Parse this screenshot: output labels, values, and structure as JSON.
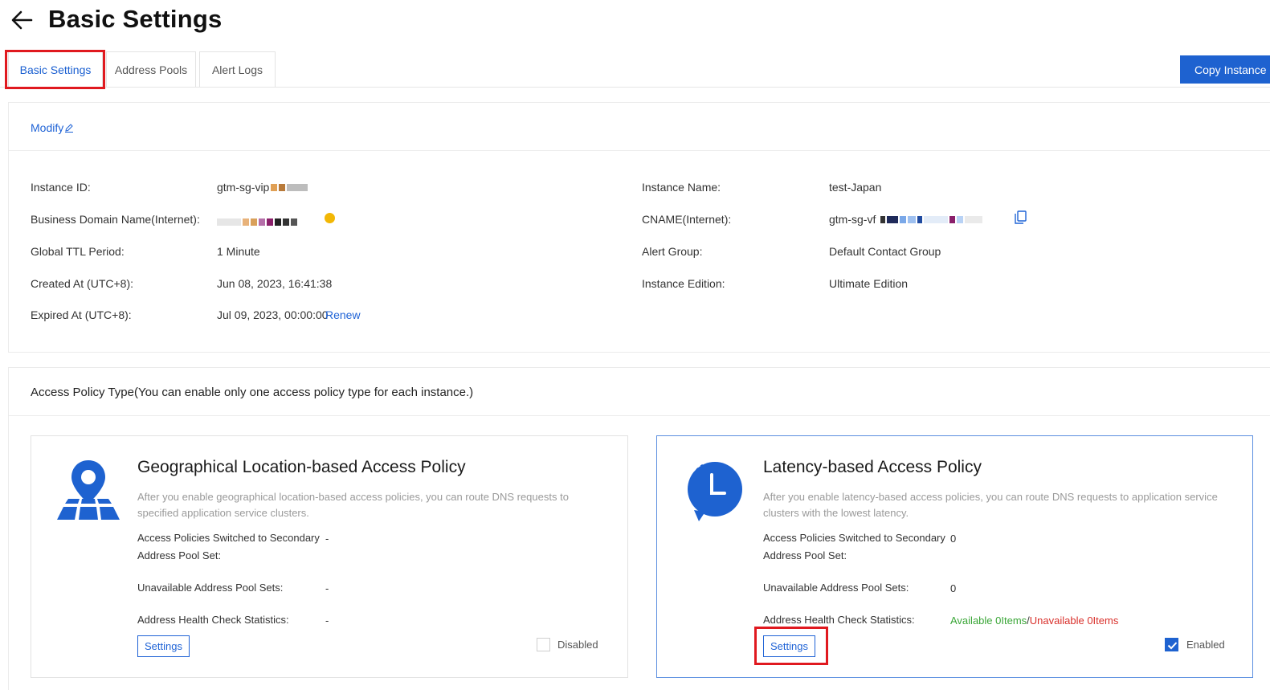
{
  "header": {
    "title": "Basic Settings"
  },
  "tabs": [
    {
      "label": "Basic Settings"
    },
    {
      "label": "Address Pools"
    },
    {
      "label": "Alert Logs"
    }
  ],
  "actions": {
    "copy_instance": "Copy Instance"
  },
  "info": {
    "modify_label": "Modify",
    "left": [
      {
        "label": "Instance ID:",
        "value": "gtm-sg-vip"
      },
      {
        "label": "Business Domain Name(Internet):",
        "value": ""
      },
      {
        "label": "Global TTL Period:",
        "value": "1 Minute"
      },
      {
        "label": "Created At (UTC+8):",
        "value": "Jun 08, 2023, 16:41:38"
      },
      {
        "label": "Expired At (UTC+8):",
        "value": "Jul 09, 2023, 00:00:00"
      }
    ],
    "renew_label": "Renew",
    "right": [
      {
        "label": "Instance Name:",
        "value": "test-Japan"
      },
      {
        "label": "CNAME(Internet):",
        "value": "gtm-sg-vf"
      },
      {
        "label": "Alert Group:",
        "value": "Default Contact Group"
      },
      {
        "label": "Instance Edition:",
        "value": "Ultimate Edition"
      }
    ]
  },
  "policy": {
    "section_title": "Access Policy Type(You can enable only one access policy type for each instance.)",
    "geo": {
      "title": "Geographical Location-based Access Policy",
      "desc": "After you enable geographical location-based access policies, you can route DNS requests to specified application service clusters.",
      "switched_label_1": "Access Policies Switched to Secondary",
      "switched_label_2": "Address Pool Set:",
      "switched_value": "-",
      "unavailable_label": "Unavailable Address Pool Sets:",
      "unavailable_value": "-",
      "health_label": "Address Health Check Statistics:",
      "health_value": "-",
      "settings_label": "Settings",
      "status_label": "Disabled",
      "enabled": false,
      "icon": "map-pin-icon"
    },
    "latency": {
      "title": "Latency-based Access Policy",
      "desc": "After you enable latency-based access policies, you can route DNS requests to application service clusters with the lowest latency.",
      "switched_label_1": "Access Policies Switched to Secondary",
      "switched_label_2": "Address Pool Set:",
      "switched_value": "0",
      "unavailable_label": "Unavailable Address Pool Sets:",
      "unavailable_value": "0",
      "health_label": "Address Health Check Statistics:",
      "health_available": "Available 0Items",
      "health_sep": "/",
      "health_unavailable": "Unavailable 0Items",
      "settings_label": "Settings",
      "status_label": "Enabled",
      "enabled": true,
      "icon": "clock-refresh-icon"
    }
  },
  "colors": {
    "accent": "#1e62d0",
    "highlight": "#e0191f",
    "available": "#3aa637",
    "unavailable": "#d9302b"
  }
}
